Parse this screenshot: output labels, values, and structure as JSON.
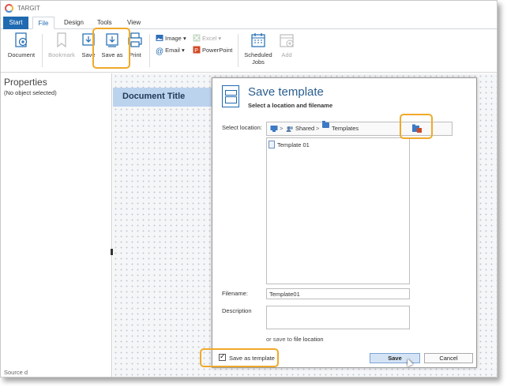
{
  "window": {
    "app_title": "TARGIT"
  },
  "tabs": [
    {
      "label": "Start"
    },
    {
      "label": "File"
    },
    {
      "label": "Design"
    },
    {
      "label": "Tools"
    },
    {
      "label": "View"
    }
  ],
  "ribbon": {
    "document": "Document",
    "bookmark": "Bookmark",
    "save": "Save",
    "save_as": "Save as",
    "print": "Print",
    "image": "Image",
    "excel": "Excel",
    "email": "Email",
    "powerpoint": "PowerPoint",
    "scheduled_jobs_line1": "Scheduled",
    "scheduled_jobs_line2": "Jobs",
    "add": "Add"
  },
  "properties": {
    "title": "Properties",
    "subtitle": "(No object selected)",
    "footer": "Source d"
  },
  "document": {
    "title": "Document Title"
  },
  "dialog": {
    "title": "Save template",
    "subtitle": "Select a location and filename",
    "select_location_label": "Select location:",
    "path": [
      "Shared",
      "Templates"
    ],
    "files": [
      "Template 01"
    ],
    "filename_label": "Filename:",
    "filename_value": "Template01",
    "description_label": "Description",
    "description_value": "",
    "or_save_to": "or save to",
    "file_location": "file location",
    "save_as_template": "Save as template",
    "save_as_template_checked": true,
    "save_button": "Save",
    "cancel_button": "Cancel"
  },
  "colors": {
    "accent": "#1f6ab1",
    "highlight": "#f0a92a",
    "doc_header": "#bcd3ee"
  }
}
